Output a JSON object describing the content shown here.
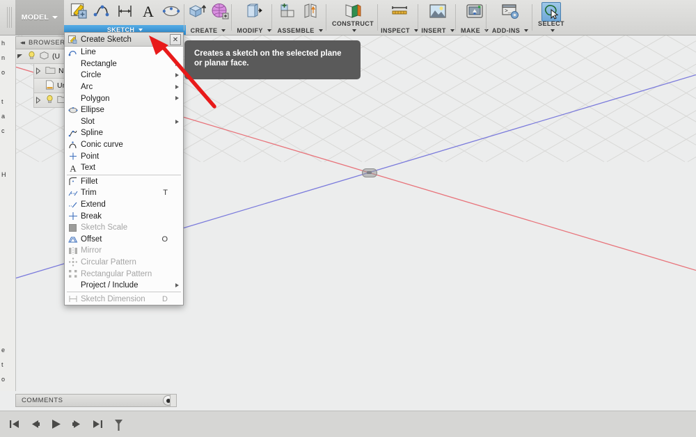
{
  "app": {
    "workspace_tab": "MODEL",
    "workspace_tab_icon": "chevron-down-icon"
  },
  "ribbon": {
    "groups": [
      {
        "id": "sketch",
        "label": "SKETCH",
        "active": true,
        "icons": [
          "create-sketch-icon",
          "spline-icon",
          "sketch-dimension-icon",
          "text-icon",
          "ellipse-icon"
        ]
      },
      {
        "id": "create",
        "label": "CREATE",
        "active": false,
        "icons": [
          "extrude-icon",
          "form-icon"
        ]
      },
      {
        "id": "modify",
        "label": "MODIFY",
        "active": false,
        "icons": [
          "press-pull-icon"
        ]
      },
      {
        "id": "assemble",
        "label": "ASSEMBLE",
        "active": false,
        "icons": [
          "new-component-icon",
          "joint-icon"
        ]
      },
      {
        "id": "construct",
        "label": "CONSTRUCT",
        "active": false,
        "icons": [
          "offset-plane-icon"
        ]
      },
      {
        "id": "inspect",
        "label": "INSPECT",
        "active": false,
        "icons": [
          "measure-icon"
        ]
      },
      {
        "id": "insert",
        "label": "INSERT",
        "active": false,
        "icons": [
          "insert-image-icon"
        ]
      },
      {
        "id": "make",
        "label": "MAKE",
        "active": false,
        "icons": [
          "3d-print-icon"
        ]
      },
      {
        "id": "addins",
        "label": "ADD-INS",
        "active": false,
        "icons": [
          "scripts-addins-icon"
        ]
      },
      {
        "id": "select",
        "label": "SELECT",
        "active": false,
        "selected": true,
        "icons": [
          "select-lasso-icon"
        ]
      }
    ]
  },
  "sketch_menu": {
    "header_label": "Create Sketch",
    "header_icon": "create-sketch-icon",
    "close_label": "✕",
    "items": [
      {
        "label": "Line",
        "icon": "line-icon",
        "key": "",
        "enabled": true,
        "submenu": false
      },
      {
        "label": "Rectangle",
        "icon": "",
        "key": "",
        "enabled": true,
        "submenu": true
      },
      {
        "label": "Circle",
        "icon": "",
        "key": "",
        "enabled": true,
        "submenu": true
      },
      {
        "label": "Arc",
        "icon": "",
        "key": "",
        "enabled": true,
        "submenu": true
      },
      {
        "label": "Polygon",
        "icon": "",
        "key": "",
        "enabled": true,
        "submenu": true
      },
      {
        "label": "Ellipse",
        "icon": "ellipse-icon",
        "key": "",
        "enabled": true,
        "submenu": false
      },
      {
        "label": "Slot",
        "icon": "",
        "key": "",
        "enabled": true,
        "submenu": true
      },
      {
        "label": "Spline",
        "icon": "spline-icon",
        "key": "",
        "enabled": true,
        "submenu": false
      },
      {
        "label": "Conic curve",
        "icon": "conic-curve-icon",
        "key": "",
        "enabled": true,
        "submenu": false
      },
      {
        "label": "Point",
        "icon": "point-icon",
        "key": "",
        "enabled": true,
        "submenu": false
      },
      {
        "label": "Text",
        "icon": "text-icon",
        "key": "",
        "enabled": true,
        "submenu": false
      },
      {
        "divider": true
      },
      {
        "label": "Fillet",
        "icon": "fillet-icon",
        "key": "",
        "enabled": true,
        "submenu": false
      },
      {
        "label": "Trim",
        "icon": "trim-icon",
        "key": "T",
        "enabled": true,
        "submenu": false
      },
      {
        "label": "Extend",
        "icon": "extend-icon",
        "key": "",
        "enabled": true,
        "submenu": false
      },
      {
        "label": "Break",
        "icon": "break-icon",
        "key": "",
        "enabled": true,
        "submenu": false
      },
      {
        "label": "Sketch Scale",
        "icon": "sketch-scale-icon",
        "key": "",
        "enabled": false,
        "submenu": false
      },
      {
        "label": "Offset",
        "icon": "offset-icon",
        "key": "O",
        "enabled": true,
        "submenu": false
      },
      {
        "label": "Mirror",
        "icon": "mirror-icon",
        "key": "",
        "enabled": false,
        "submenu": false
      },
      {
        "label": "Circular Pattern",
        "icon": "circular-pattern-icon",
        "key": "",
        "enabled": false,
        "submenu": false
      },
      {
        "label": "Rectangular Pattern",
        "icon": "rectangular-pattern-icon",
        "key": "",
        "enabled": false,
        "submenu": false
      },
      {
        "label": "Project / Include",
        "icon": "",
        "key": "",
        "enabled": true,
        "submenu": true
      },
      {
        "divider": true
      },
      {
        "label": "Sketch Dimension",
        "icon": "sketch-dimension-icon",
        "key": "D",
        "enabled": false,
        "submenu": false
      }
    ]
  },
  "tooltip": {
    "text": "Creates a sketch on the selected plane or planar face."
  },
  "browser": {
    "title": "BROWSER",
    "collapse_icon": "collapse-left-icon",
    "tree": [
      {
        "label": "(U",
        "icon": "component-icon",
        "bulb": true,
        "twisty": "down",
        "indent": 0
      },
      {
        "label": "Nar",
        "icon": "folder-icon",
        "bulb": false,
        "twisty": "right",
        "indent": 1
      },
      {
        "label": "Uni",
        "icon": "document-icon",
        "bulb": false,
        "twisty": "none",
        "indent": 1
      },
      {
        "label": "",
        "icon": "folder-icon",
        "bulb": true,
        "twisty": "right",
        "indent": 1
      }
    ]
  },
  "edge_strip": {
    "chars": [
      "h",
      "n",
      "o",
      "",
      "t",
      "a",
      "c",
      "",
      "",
      "H",
      "",
      "",
      "",
      "",
      "",
      "",
      "",
      "",
      "",
      "",
      "",
      "e",
      "t",
      "o",
      "o"
    ]
  },
  "comments": {
    "title": "COMMENTS",
    "gear_icon": "settings-icon"
  },
  "timeline": {
    "buttons": [
      {
        "name": "go-to-beginning-button",
        "icon": "skip-back-icon"
      },
      {
        "name": "step-back-button",
        "icon": "step-back-icon"
      },
      {
        "name": "play-button",
        "icon": "play-icon"
      },
      {
        "name": "step-forward-button",
        "icon": "step-forward-icon"
      },
      {
        "name": "go-to-end-button",
        "icon": "skip-forward-icon"
      },
      {
        "name": "timeline-marker",
        "icon": "marker-pin-icon"
      }
    ]
  },
  "viewport": {
    "origin_label": "origin-point",
    "axis_red_color": "#e8737a",
    "axis_blue_color": "#7b7bdc",
    "grid_color": "#d8d8d6",
    "background_color": "#eceded"
  },
  "annotation": {
    "arrow_color": "#e81a1a"
  }
}
